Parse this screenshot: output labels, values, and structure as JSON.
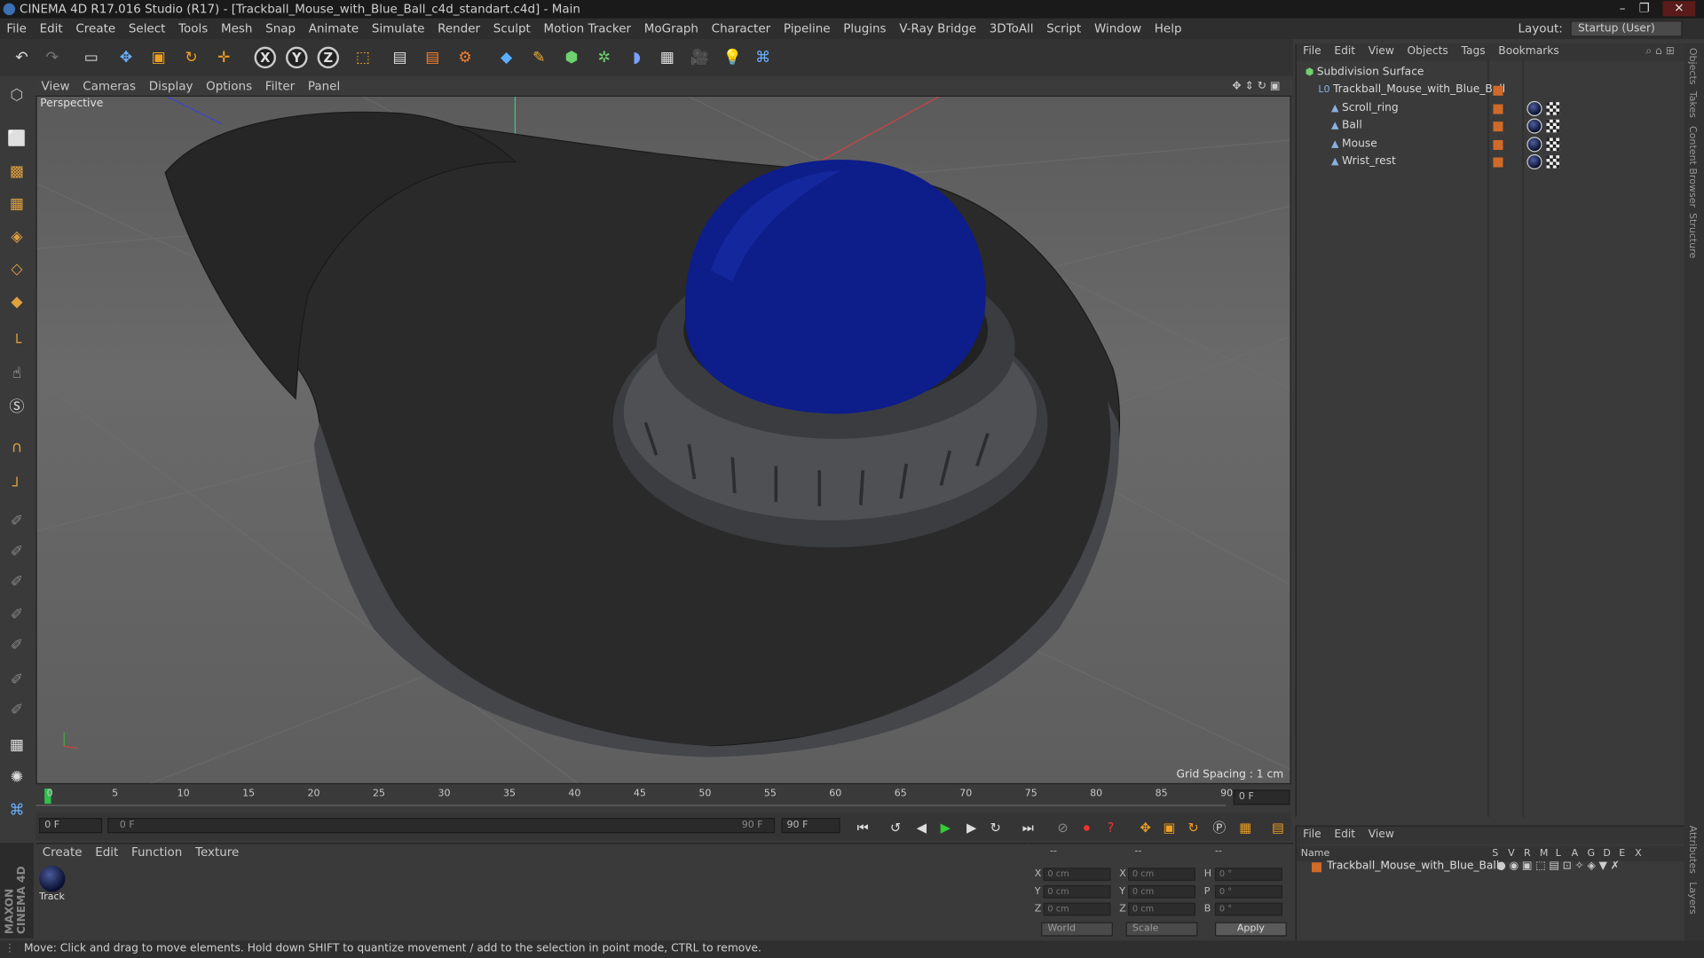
{
  "window": {
    "title": "CINEMA 4D R17.016 Studio (R17) - [Trackball_Mouse_with_Blue_Ball_c4d_standart.c4d] - Main"
  },
  "menu": [
    "File",
    "Edit",
    "Create",
    "Select",
    "Tools",
    "Mesh",
    "Snap",
    "Animate",
    "Simulate",
    "Render",
    "Sculpt",
    "Motion Tracker",
    "MoGraph",
    "Character",
    "Pipeline",
    "Plugins",
    "V-Ray Bridge",
    "3DToAll",
    "Script",
    "Window",
    "Help"
  ],
  "layout": {
    "label": "Layout:",
    "value": "Startup (User)"
  },
  "toolbar": {
    "axis_x": "X",
    "axis_y": "Y",
    "axis_z": "Z"
  },
  "viewport": {
    "menu": [
      "View",
      "Cameras",
      "Display",
      "Options",
      "Filter",
      "Panel"
    ],
    "label": "Perspective",
    "grid_spacing": "Grid Spacing : 1 cm"
  },
  "timeline": {
    "ticks": [
      "0",
      "5",
      "10",
      "15",
      "20",
      "25",
      "30",
      "35",
      "40",
      "45",
      "50",
      "55",
      "60",
      "65",
      "70",
      "75",
      "80",
      "85",
      "90"
    ],
    "frame_end": "0 F"
  },
  "transport": {
    "start": "0 F",
    "slider_start": "0 F",
    "slider_end": "90 F",
    "end": "90 F"
  },
  "materials": {
    "menu": [
      "Create",
      "Edit",
      "Function",
      "Texture"
    ],
    "items": [
      {
        "name": "Track"
      }
    ]
  },
  "attributes": {
    "rows": [
      {
        "a": "X",
        "av": "0 cm",
        "b": "X",
        "bv": "0 cm",
        "c": "H",
        "cv": "0 °"
      },
      {
        "a": "Y",
        "av": "0 cm",
        "b": "Y",
        "bv": "0 cm",
        "c": "P",
        "cv": "0 °"
      },
      {
        "a": "Z",
        "av": "0 cm",
        "b": "Z",
        "bv": "0 cm",
        "c": "B",
        "cv": "0 °"
      }
    ],
    "coord_mode": "World",
    "scale_mode": "Scale",
    "apply": "Apply",
    "dashes": [
      "--",
      "--",
      "--"
    ]
  },
  "objects": {
    "menu": [
      "File",
      "Edit",
      "View",
      "Objects",
      "Tags",
      "Bookmarks"
    ],
    "items": [
      {
        "name": "Subdivision Surface",
        "level": 0
      },
      {
        "name": "Trackball_Mouse_with_Blue_Ball",
        "level": 1
      },
      {
        "name": "Scroll_ring",
        "level": 2
      },
      {
        "name": "Ball",
        "level": 2
      },
      {
        "name": "Mouse",
        "level": 2
      },
      {
        "name": "Wrist_rest",
        "level": 2
      }
    ]
  },
  "layers": {
    "menu": [
      "File",
      "Edit",
      "View"
    ],
    "header_name": "Name",
    "columns": [
      "S",
      "V",
      "R",
      "M",
      "L",
      "A",
      "G",
      "D",
      "E",
      "X"
    ],
    "item": "Trackball_Mouse_with_Blue_Ball"
  },
  "side_tabs": [
    "Objects",
    "Takes",
    "Content Browser",
    "Structure",
    "Attributes",
    "Layers"
  ],
  "status": "Move: Click and drag to move elements. Hold down SHIFT to quantize movement / add to the selection in point mode, CTRL to remove.",
  "logo": {
    "line1": "MAXON",
    "line2": "CINEMA 4D"
  },
  "colors": {
    "ball": "#0d1d8a",
    "accent": "#d06a28"
  }
}
